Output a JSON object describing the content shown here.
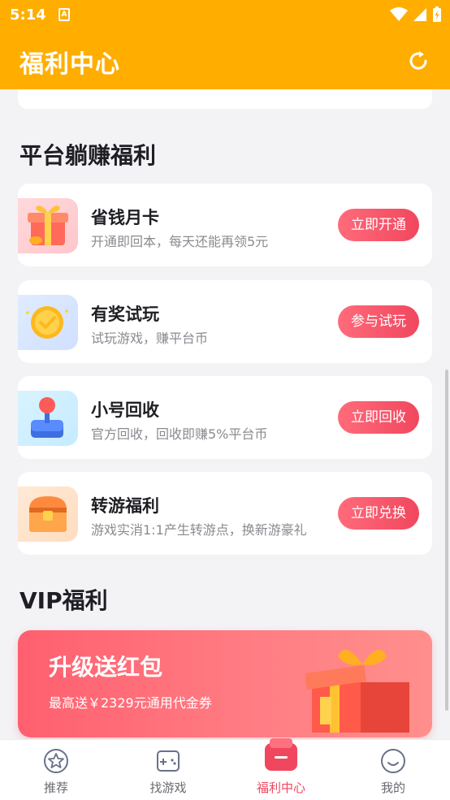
{
  "status_bar": {
    "time": "5:14",
    "notification_icon": "A"
  },
  "app_bar": {
    "title": "福利中心",
    "refresh_icon": "refresh-icon"
  },
  "platform_section": {
    "title": "平台躺赚福利",
    "items": [
      {
        "name": "省钱月卡",
        "desc": "开通即回本，每天还能再领5元",
        "button": "立即开通",
        "icon": "gift-box-icon"
      },
      {
        "name": "有奖试玩",
        "desc": "试玩游戏，赚平台币",
        "button": "参与试玩",
        "icon": "gold-coin-icon"
      },
      {
        "name": "小号回收",
        "desc": "官方回收，回收即赚5%平台币",
        "button": "立即回收",
        "icon": "joystick-icon"
      },
      {
        "name": "转游福利",
        "desc": "游戏实消1:1产生转游点，换新游豪礼",
        "button": "立即兑换",
        "icon": "treasure-chest-icon"
      }
    ]
  },
  "vip_section": {
    "title": "VIP福利",
    "banner_title": "升级送红包",
    "banner_subtitle": "最高送￥2329元通用代金券"
  },
  "tab_bar": {
    "tabs": [
      {
        "label": "推荐",
        "icon": "star-icon",
        "active": false
      },
      {
        "label": "找游戏",
        "icon": "gamepad-icon",
        "active": false
      },
      {
        "label": "福利中心",
        "icon": "welfare-icon",
        "active": true
      },
      {
        "label": "我的",
        "icon": "smile-icon",
        "active": false
      }
    ]
  },
  "colors": {
    "brand": "#ffae00",
    "accent": "#f0475f",
    "background": "#f3f3f6"
  }
}
